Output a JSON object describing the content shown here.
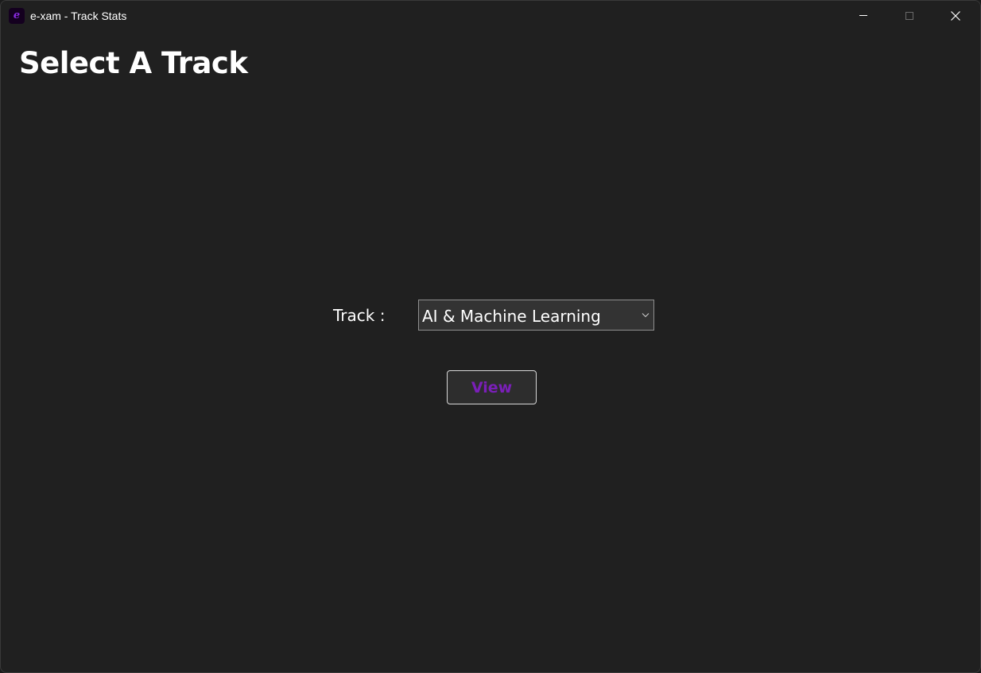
{
  "window": {
    "title": "e-xam - Track Stats",
    "app_icon_glyph": "e",
    "icon": "app-logo-icon",
    "controls": {
      "minimize_icon": "minimize-icon",
      "maximize_icon": "maximize-icon",
      "close_icon": "close-icon"
    }
  },
  "page": {
    "title": "Select A Track"
  },
  "form": {
    "track_label": "Track :",
    "track_selected": "AI & Machine Learning",
    "dropdown_icon": "chevron-down-icon",
    "view_label": "View"
  },
  "colors": {
    "background": "#202020",
    "accent": "#7a1fb8",
    "text": "#ffffff",
    "control_border": "#8f8f8f"
  }
}
